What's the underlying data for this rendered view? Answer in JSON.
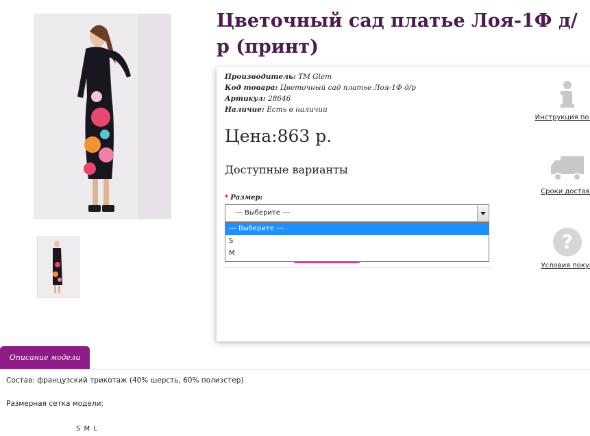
{
  "product": {
    "title": "Цветочный сад платье Лоя-1Ф д/р (принт)",
    "manufacturer_label": "Производитель:",
    "manufacturer_value": "TM Glem",
    "code_label": "Код товара:",
    "code_value": "Цветочный сад платье Лоя-1Ф д/р",
    "article_label": "Артикул:",
    "article_value": "28646",
    "availability_label": "Наличие:",
    "availability_value": "Есть в наличии",
    "price": "Цена:863 р."
  },
  "options": {
    "heading": "Доступные варианты",
    "size_label": "Размер:",
    "required_mark": "*",
    "selected": "--- Выберите ---",
    "items": [
      "--- Выберите ---",
      "S",
      "M"
    ]
  },
  "sidebar": {
    "instruction": "Инструкция по по",
    "delivery": "Сроки доставк",
    "terms": "Условия покуп"
  },
  "tabs": {
    "description": "Описание модели"
  },
  "description": {
    "composition": "Состав: французский трикотаж (40% шерсть, 60% полиэстер)",
    "size_grid_label": "Размерная сетка модели:",
    "sizes_row": "S M L"
  },
  "colors": {
    "title": "#4b1c4f",
    "tab": "#8e1c86",
    "select_highlight": "#1e90ff",
    "button": "#e0398f",
    "icon_gray": "#c8c8c8"
  }
}
